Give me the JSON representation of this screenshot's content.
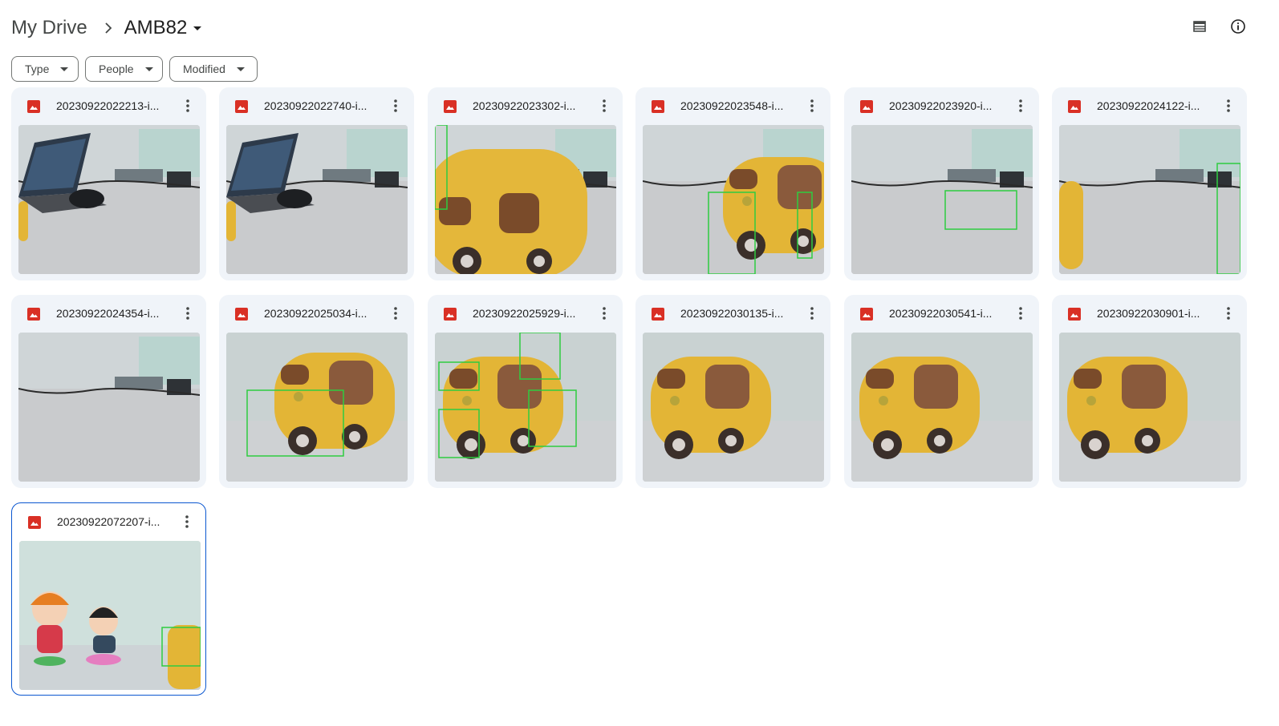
{
  "breadcrumb": {
    "root": "My Drive",
    "current": "AMB82"
  },
  "header_icons": [
    "list-view-icon",
    "info-icon"
  ],
  "filters": [
    {
      "label": "Type"
    },
    {
      "label": "People"
    },
    {
      "label": "Modified"
    }
  ],
  "files": [
    {
      "name": "20230922022213-i...",
      "scene": "laptop-desk"
    },
    {
      "name": "20230922022740-i...",
      "scene": "laptop-desk"
    },
    {
      "name": "20230922023302-i...",
      "scene": "bus-close"
    },
    {
      "name": "20230922023548-i...",
      "scene": "bus-right"
    },
    {
      "name": "20230922023920-i...",
      "scene": "desk-box"
    },
    {
      "name": "20230922024122-i...",
      "scene": "desk-edge"
    },
    {
      "name": "20230922024354-i...",
      "scene": "desk-empty"
    },
    {
      "name": "20230922025034-i...",
      "scene": "bus-box"
    },
    {
      "name": "20230922025929-i...",
      "scene": "bus-multi"
    },
    {
      "name": "20230922030135-i...",
      "scene": "bus"
    },
    {
      "name": "20230922030541-i...",
      "scene": "bus"
    },
    {
      "name": "20230922030901-i...",
      "scene": "bus"
    },
    {
      "name": "20230922072207-i...",
      "scene": "figures",
      "selected": true
    }
  ],
  "colors": {
    "image_icon": "#d93025",
    "selected_border": "#0b57d0",
    "card_bg": "#f0f4f9",
    "detect_box": "#2ecc40"
  }
}
